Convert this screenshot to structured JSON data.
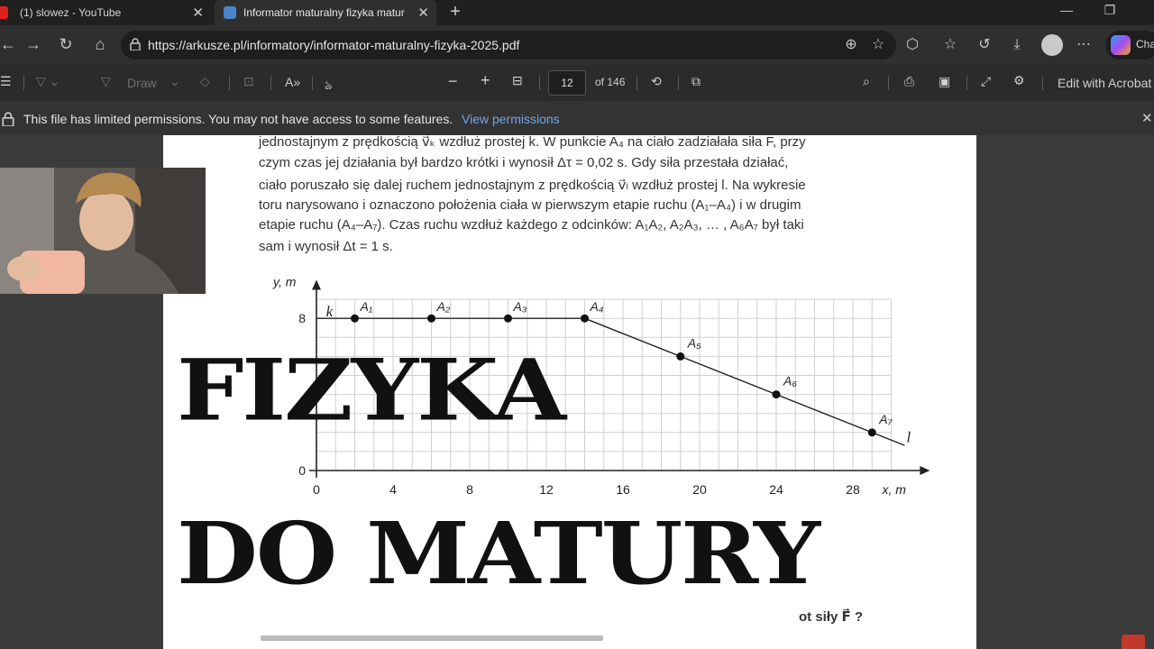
{
  "tabs": [
    {
      "title": "(1) slowez - YouTube"
    },
    {
      "title": "Informator maturalny fizyka matur"
    }
  ],
  "address": {
    "url": "https://arkusze.pl/informatory/informator-maturalny-fizyka-2025.pdf",
    "copilot_label": "Cha"
  },
  "pdf_toolbar": {
    "draw_label": "Draw",
    "page_number": "12",
    "page_total": "of 146",
    "edit_label": "Edit with Acrobat"
  },
  "permissions": {
    "message": "This file has limited permissions. You may not have access to some features.",
    "link": "View permissions"
  },
  "document": {
    "lines": [
      "jednostajnym z prędkością v⃗ₖ wzdłuż prostej k. W punkcie A₄ na ciało zadziałała siła F, przy",
      "czym czas jej działania był bardzo krótki i wynosił Δτ = 0,02 s. Gdy siła przestała działać,",
      "ciało poruszało się dalej ruchem jednostajnym z prędkością v⃗ₗ wzdłuż prostej l. Na wykresie",
      "toru narysowano i oznaczono położenia  ciała w pierwszym etapie ruchu (A₁–A₄) i w drugim",
      "etapie ruchu (A₄–A₇). Czas ruchu wzdłuż każdego z odcinków: A₁A₂, A₂A₃, … , A₆A₇ był taki",
      "sam i wynosił Δt = 1 s."
    ],
    "bottom_fragment": "ot siły F⃗ ?"
  },
  "chart_data": {
    "type": "scatter",
    "xlabel": "x, m",
    "ylabel": "y, m",
    "x_ticks": [
      "0",
      "4",
      "8",
      "12",
      "16",
      "20",
      "24",
      "28"
    ],
    "y_ticks": [
      "0",
      "8"
    ],
    "xlim": [
      0,
      30
    ],
    "ylim": [
      0,
      8
    ],
    "grid": true,
    "line_labels": [
      "k",
      "l"
    ],
    "points": [
      {
        "label": "A₁",
        "x": 2,
        "y": 8
      },
      {
        "label": "A₂",
        "x": 6,
        "y": 8
      },
      {
        "label": "A₃",
        "x": 10,
        "y": 8
      },
      {
        "label": "A₄",
        "x": 14,
        "y": 8
      },
      {
        "label": "A₅",
        "x": 19,
        "y": 6
      },
      {
        "label": "A₆",
        "x": 24,
        "y": 4
      },
      {
        "label": "A₇",
        "x": 29,
        "y": 2
      }
    ]
  },
  "overlay": {
    "title_line1": "FIZYKA",
    "title_line2": "DO MATURY"
  },
  "colors": {
    "page_bg": "#ffffff",
    "app_bg": "#3b3b3b",
    "link": "#72a8e6"
  }
}
